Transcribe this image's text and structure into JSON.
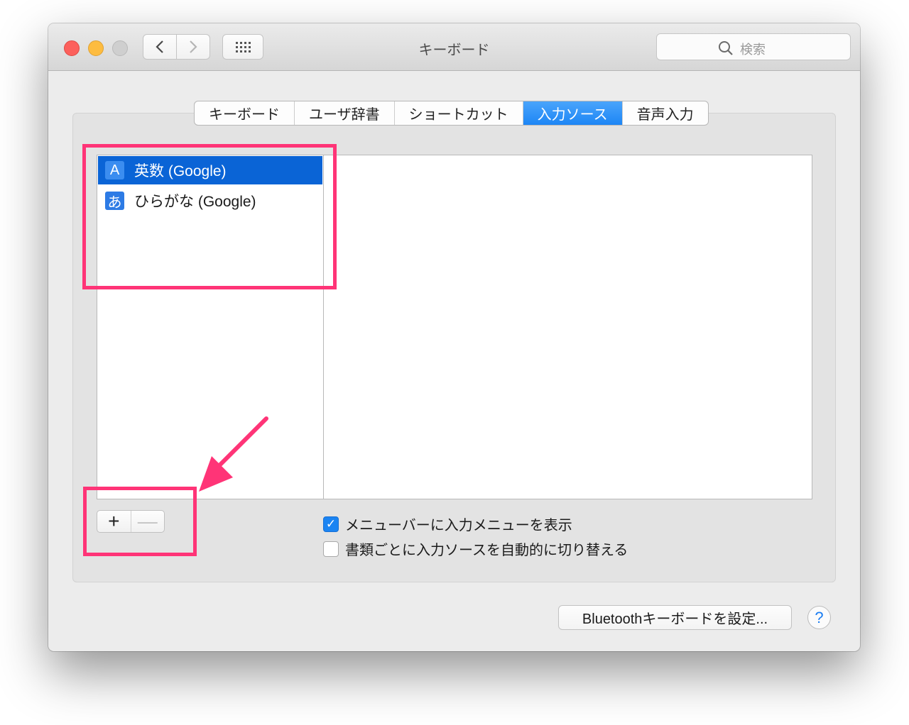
{
  "window": {
    "title": "キーボード",
    "search_placeholder": "検索",
    "back_icon": "chevron-left",
    "forward_icon": "chevron-right",
    "grid_icon": "show-all-grid"
  },
  "tabs": [
    {
      "label": "キーボード",
      "active": false
    },
    {
      "label": "ユーザ辞書",
      "active": false
    },
    {
      "label": "ショートカット",
      "active": false
    },
    {
      "label": "入力ソース",
      "active": true
    },
    {
      "label": "音声入力",
      "active": false
    }
  ],
  "input_sources": [
    {
      "icon_text": "A",
      "label": "英数 (Google)",
      "selected": true
    },
    {
      "icon_text": "あ",
      "label": "ひらがな (Google)",
      "selected": false
    }
  ],
  "list_buttons": {
    "add": "+",
    "remove": "—"
  },
  "options": [
    {
      "label": "メニューバーに入力メニューを表示",
      "checked": true
    },
    {
      "label": "書類ごとに入力ソースを自動的に切り替える",
      "checked": false
    }
  ],
  "bluetooth_button": "Bluetoothキーボードを設定...",
  "help_button": "?",
  "colors": {
    "accent": "#1d86f5",
    "selection": "#0a64d6",
    "annotation": "#ff3477"
  }
}
